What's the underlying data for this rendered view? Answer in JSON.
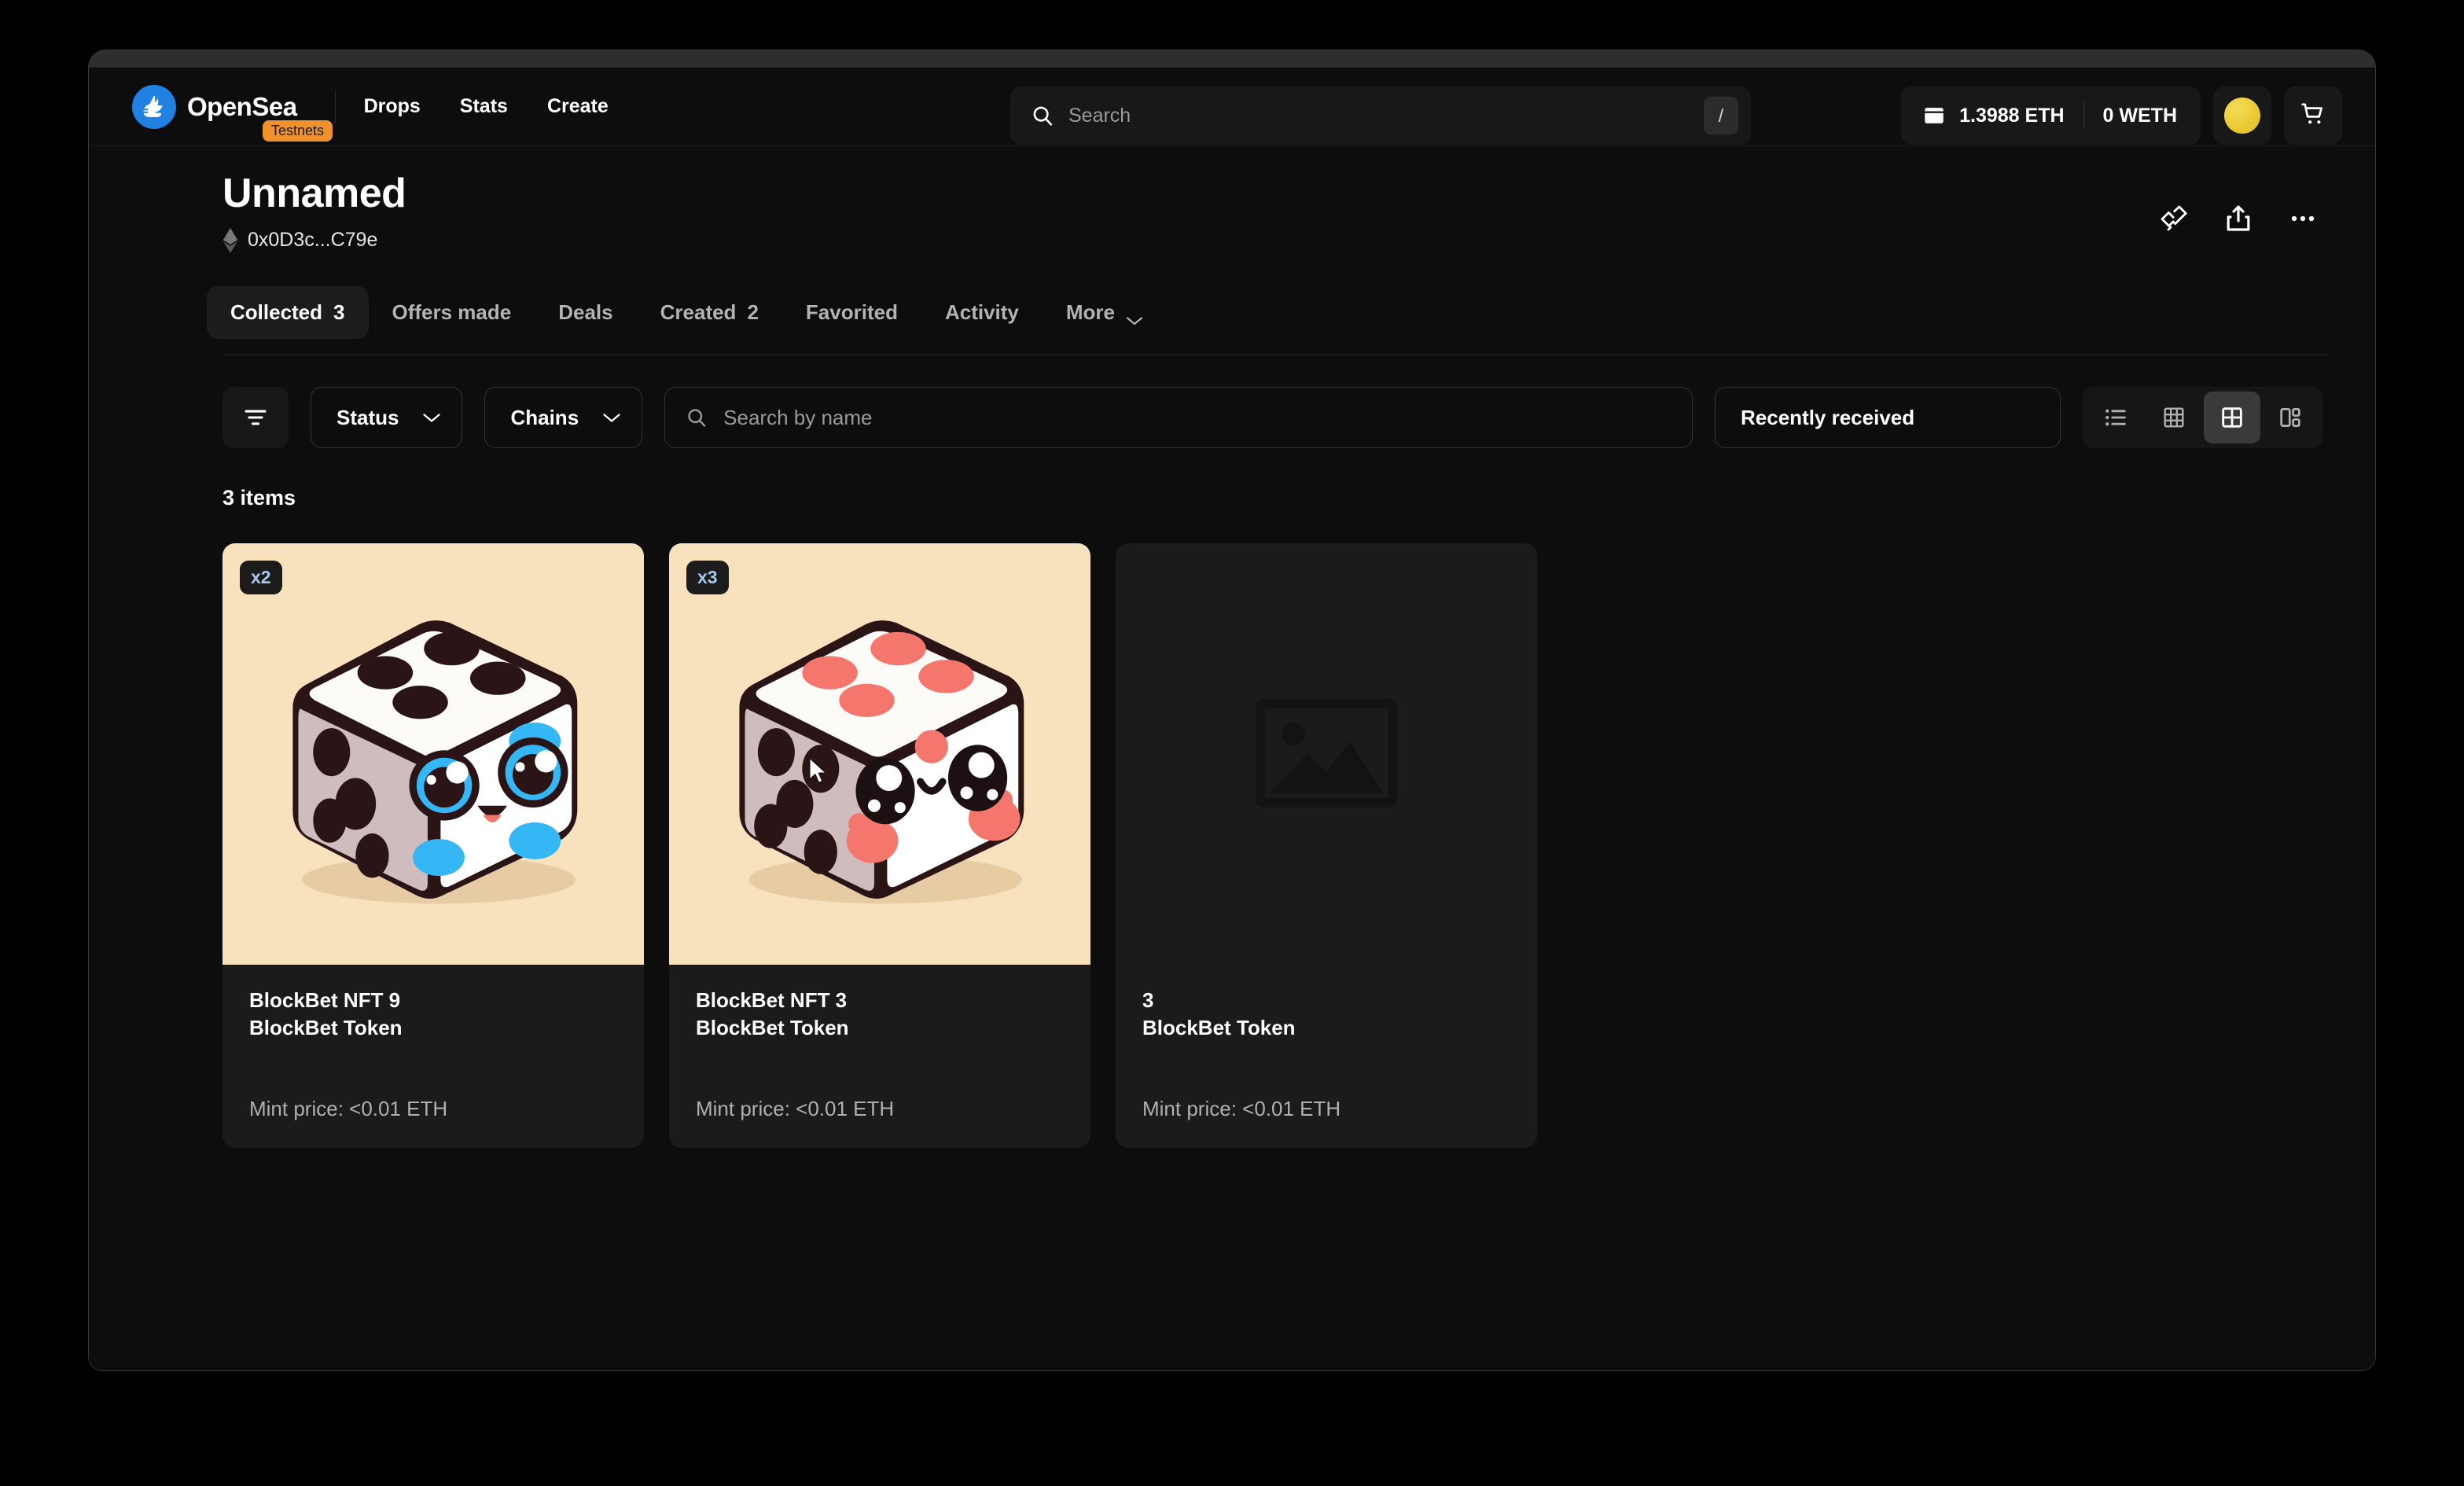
{
  "brand": {
    "name": "OpenSea",
    "badge": "Testnets",
    "logo_icon": "opensea-sailboat-icon",
    "accent": "#2081e2"
  },
  "nav": {
    "links": [
      {
        "label": "Drops"
      },
      {
        "label": "Stats"
      },
      {
        "label": "Create"
      }
    ]
  },
  "search": {
    "placeholder": "Search",
    "value": "",
    "shortcut": "/",
    "icon": "search-icon"
  },
  "wallet": {
    "icon": "wallet-icon",
    "eth_balance": "1.3988 ETH",
    "weth_balance": "0 WETH",
    "avatar_color": "#e8c931",
    "cart_icon": "shopping-cart-icon"
  },
  "profile": {
    "title": "Unnamed",
    "chain_icon": "ethereum-icon",
    "address": "0x0D3c...C79e",
    "actions": [
      {
        "name": "deals-icon"
      },
      {
        "name": "share-icon"
      },
      {
        "name": "more-icon"
      }
    ]
  },
  "tabs": [
    {
      "label": "Collected",
      "count": "3",
      "active": true
    },
    {
      "label": "Offers made",
      "count": "",
      "active": false
    },
    {
      "label": "Deals",
      "count": "",
      "active": false
    },
    {
      "label": "Created",
      "count": "2",
      "active": false
    },
    {
      "label": "Favorited",
      "count": "",
      "active": false
    },
    {
      "label": "Activity",
      "count": "",
      "active": false
    },
    {
      "label": "More",
      "count": "",
      "active": false,
      "chevron": true
    }
  ],
  "filters": {
    "filter_toggle_icon": "filter-icon",
    "status": {
      "label": "Status"
    },
    "chains": {
      "label": "Chains"
    },
    "name_search": {
      "placeholder": "Search by name",
      "value": "",
      "icon": "search-icon"
    },
    "sort": {
      "label": "Recently received"
    },
    "views": [
      {
        "name": "view-list",
        "icon": "list-view-icon",
        "active": false
      },
      {
        "name": "view-dense-grid",
        "icon": "dense-grid-icon",
        "active": false
      },
      {
        "name": "view-grid",
        "icon": "grid-view-icon",
        "active": true
      },
      {
        "name": "view-details",
        "icon": "details-view-icon",
        "active": false
      }
    ]
  },
  "results": {
    "count_label": "3 items",
    "items": [
      {
        "badge": "x2",
        "title": "BlockBet NFT 9",
        "collection": "BlockBet Token",
        "price": "Mint price: <0.01 ETH",
        "art": "dice-blue",
        "has_art": true
      },
      {
        "badge": "x3",
        "title": "BlockBet NFT 3",
        "collection": "BlockBet Token",
        "price": "Mint price: <0.01 ETH",
        "art": "dice-red",
        "has_art": true
      },
      {
        "badge": "",
        "title": "3",
        "collection": "BlockBet Token",
        "price": "Mint price: <0.01 ETH",
        "art": "image-placeholder-icon",
        "has_art": false
      }
    ]
  }
}
